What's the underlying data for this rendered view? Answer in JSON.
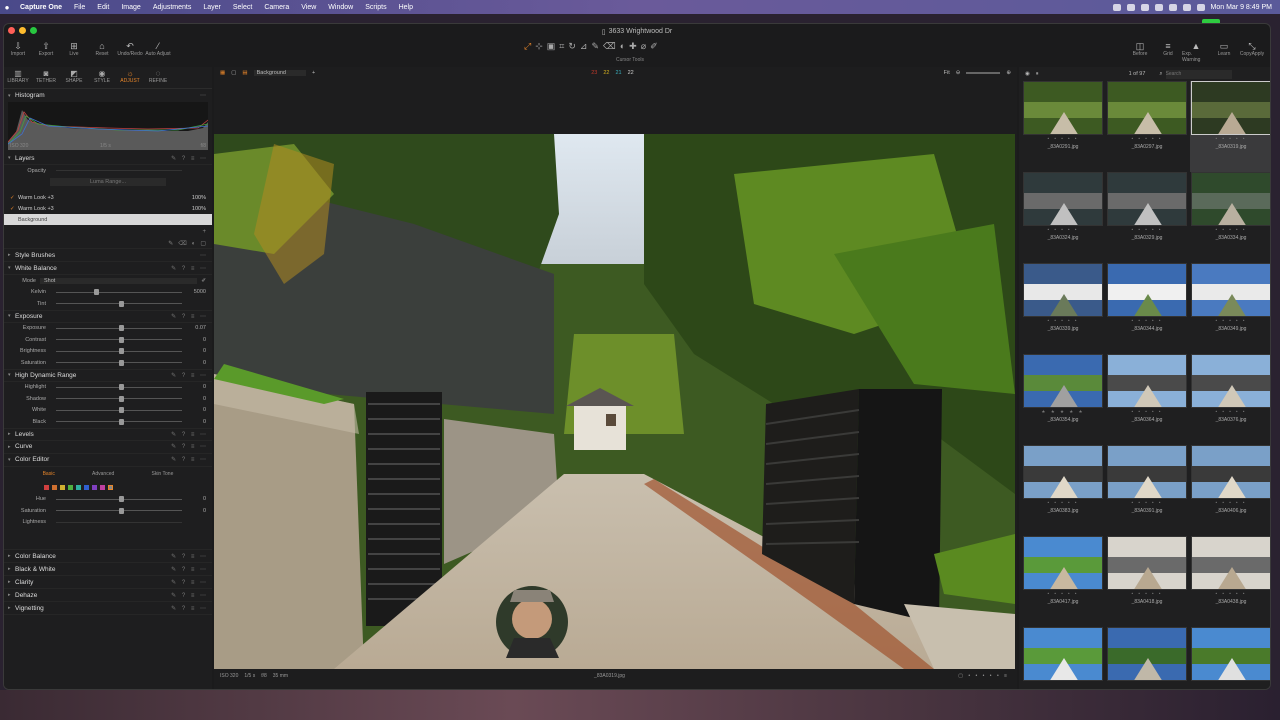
{
  "menubar": {
    "app": "Capture One",
    "items": [
      "File",
      "Edit",
      "Image",
      "Adjustments",
      "Layer",
      "Select",
      "Camera",
      "View",
      "Window",
      "Scripts",
      "Help"
    ],
    "clock": "Mon Mar 9  8:49 PM"
  },
  "badge": {
    "letter": "K",
    "number": "4"
  },
  "window": {
    "title": "3633 Wrightwood Dr"
  },
  "toolbar": {
    "left": [
      "Import",
      "Export",
      "Live",
      "Reset",
      "Undo/Redo",
      "Auto Adjust"
    ],
    "cursor_label": "Cursor Tools",
    "right": [
      "Before",
      "Grid",
      "Exp. Warning",
      "Learn",
      "CopyApply"
    ]
  },
  "tooltabs": [
    "LIBRARY",
    "TETHER",
    "SHAPE",
    "STYLE",
    "ADJUST",
    "REFINE"
  ],
  "left": {
    "histogram": "Histogram",
    "histo_info": {
      "iso": "ISO 320",
      "shutter": "1/5 s",
      "aperture": "f/8"
    },
    "layers": "Layers",
    "opacity": "Opacity",
    "luma": "Luma Range...",
    "layer_items": [
      {
        "name": "Warm Look +3",
        "pct": "100%"
      },
      {
        "name": "Warm Look +3",
        "pct": "100%"
      },
      {
        "name": "Background",
        "pct": ""
      }
    ],
    "style_brushes": "Style Brushes",
    "white_balance": "White Balance",
    "wb_mode_label": "Mode",
    "wb_mode": "Shot",
    "kelvin_label": "Kelvin",
    "kelvin": "5000",
    "tint_label": "Tint",
    "exposure": "Exposure",
    "exp_rows": [
      {
        "label": "Exposure",
        "value": "0.07"
      },
      {
        "label": "Contrast",
        "value": "0"
      },
      {
        "label": "Brightness",
        "value": "0"
      },
      {
        "label": "Saturation",
        "value": "0"
      }
    ],
    "hdr": "High Dynamic Range",
    "hdr_rows": [
      {
        "label": "Highlight",
        "value": "0"
      },
      {
        "label": "Shadow",
        "value": "0"
      },
      {
        "label": "White",
        "value": "0"
      },
      {
        "label": "Black",
        "value": "0"
      }
    ],
    "levels": "Levels",
    "curve": "Curve",
    "color_editor": "Color Editor",
    "ce_tabs": [
      "Basic",
      "Advanced",
      "Skin Tone"
    ],
    "ce_rows": [
      {
        "label": "Hue",
        "value": "0"
      },
      {
        "label": "Saturation",
        "value": "0"
      },
      {
        "label": "Lightness",
        "value": ""
      }
    ],
    "bottom_sections": [
      "Color Balance",
      "Black & White",
      "Clarity",
      "Dehaze",
      "Vignetting"
    ]
  },
  "viewer": {
    "variant": "Background",
    "counts": [
      "23",
      "22",
      "21",
      "22"
    ],
    "fit": "Fit",
    "status": {
      "iso": "ISO 320",
      "shutter": "1/5 s",
      "aperture": "f/8",
      "focal": "35 mm",
      "file": "_83A0319.jpg"
    }
  },
  "browser": {
    "count": "1 of 97",
    "search_placeholder": "Search",
    "files": [
      "_83A0291.jpg",
      "_83A0297.jpg",
      "_83A0319.jpg",
      "_83A0324.jpg",
      "_83A0329.jpg",
      "_83A0334.jpg",
      "_83A0339.jpg",
      "_83A0344.jpg",
      "_83A0349.jpg",
      "_83A0354.jpg",
      "_83A0364.jpg",
      "_83A0376.jpg",
      "_83A0383.jpg",
      "_83A0391.jpg",
      "_83A0406.jpg",
      "_83A0417.jpg",
      "_83A0418.jpg",
      "_83A0438.jpg",
      "",
      "",
      ""
    ],
    "ratings": [
      "• • • • •",
      "• • • • •",
      "• • • • •",
      "• • • • •",
      "• • • • •",
      "• • • • •",
      "• • • • •",
      "• • • • •",
      "• • • • •",
      "★ ★ ★ ★ ★",
      "• • • • •",
      "• • • • •",
      "• • • • •",
      "• • • • •",
      "• • • • •",
      "• • • • •",
      "• • • • •",
      "• • • • •",
      "",
      "",
      ""
    ]
  }
}
